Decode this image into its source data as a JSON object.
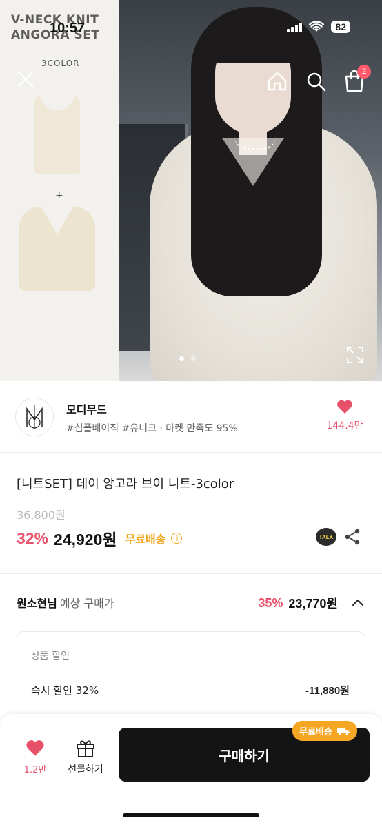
{
  "status_bar": {
    "time": "10:57",
    "battery": "82"
  },
  "hero": {
    "product_title_line1": "V-NECK KNIT",
    "product_title_line2": "ANGORA SET",
    "color_count": "3COLOR",
    "plus_sign": "+",
    "cart_count": "2",
    "page_indicator": {
      "current": 1,
      "total": 2
    }
  },
  "shop": {
    "name": "모디무드",
    "tags": "#심플베이직 #유니크 · 마켓 만족도 95%",
    "like_count": "144.4만"
  },
  "product": {
    "name": "[니트SET] 데이 앙고라 브이 니트-3color",
    "original_price": "36,800원",
    "discount": "32%",
    "price": "24,920원",
    "free_shipping": "무료배송",
    "info_icon": "i",
    "talk_label": "TALK"
  },
  "expected": {
    "user": "원소현님",
    "label": "예상 구매가",
    "discount": "35%",
    "price": "23,770원"
  },
  "discount_box": {
    "title": "상품 할인",
    "label": "즉시 할인 32%",
    "value": "-11,880원"
  },
  "bottom_bar": {
    "like_count": "1.2만",
    "gift_label": "선물하기",
    "buy_label": "구매하기",
    "buy_badge": "무료배송"
  },
  "colors": {
    "accent": "#e8516a",
    "shipping": "#f0a81c",
    "buy_button": "#141414"
  }
}
